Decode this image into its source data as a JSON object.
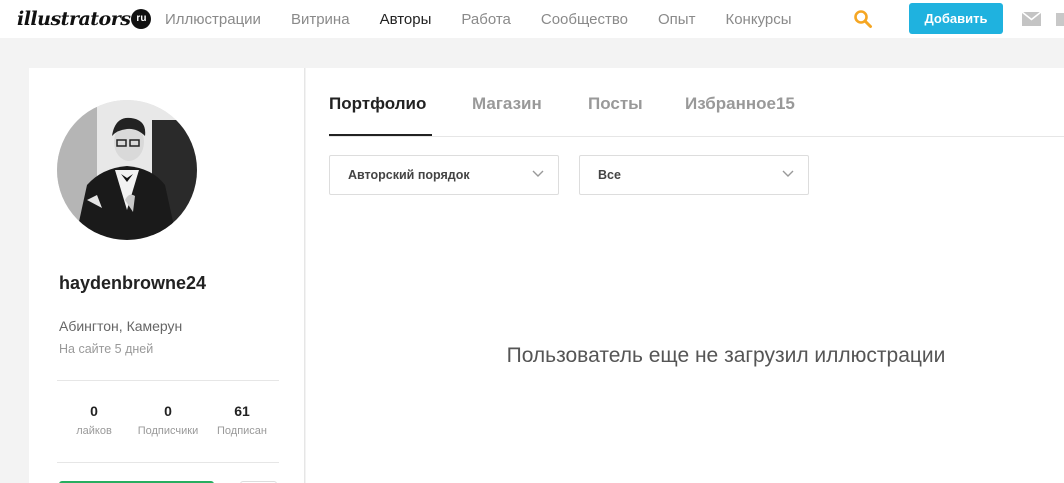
{
  "logo": {
    "text": "illustrators",
    "badge": "ru"
  },
  "nav": {
    "items": [
      {
        "label": "Иллюстрации",
        "active": false
      },
      {
        "label": "Витрина",
        "active": false
      },
      {
        "label": "Авторы",
        "active": true
      },
      {
        "label": "Работа",
        "active": false
      },
      {
        "label": "Сообщество",
        "active": false
      },
      {
        "label": "Опыт",
        "active": false
      },
      {
        "label": "Конкурсы",
        "active": false
      }
    ],
    "add_label": "Добавить",
    "icons": [
      "search-icon",
      "mail-icon"
    ]
  },
  "profile": {
    "username": "haydenbrowne24",
    "location": "Абингтон, Камерун",
    "on_site": "На сайте 5 дней",
    "stats": [
      {
        "value": "0",
        "label": "лайков"
      },
      {
        "value": "0",
        "label": "Подписчики"
      },
      {
        "value": "61",
        "label": "Подписан"
      }
    ]
  },
  "tabs": [
    {
      "label": "Портфолио",
      "active": true
    },
    {
      "label": "Магазин",
      "active": false
    },
    {
      "label": "Посты",
      "active": false
    },
    {
      "label": "Избранное15",
      "active": false
    }
  ],
  "filters": {
    "order_value": "Авторский порядок",
    "category_value": "Все"
  },
  "empty_message": "Пользователь еще не загрузил иллюстрации",
  "colors": {
    "accent": "#1fb2df",
    "follow": "#27ae60",
    "search": "#f5a623"
  }
}
